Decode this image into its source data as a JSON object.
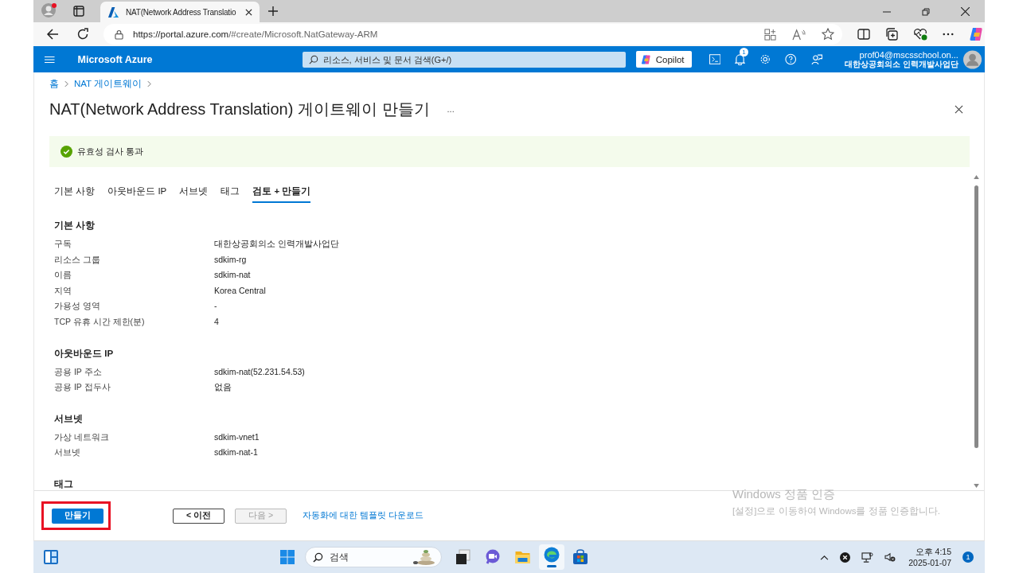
{
  "browser": {
    "tab_title": "NAT(Network Address Translatio",
    "url_host": "https://portal.azure.com",
    "url_path": "/#create/Microsoft.NatGateway-ARM"
  },
  "portal": {
    "brand": "Microsoft Azure",
    "search": {
      "placeholder": "리소스, 서비스 및 문서 검색(G+/)"
    },
    "copilot": "Copilot",
    "notification_count": "1",
    "account": "prof04@mscsschool.on...",
    "directory": "대한상공회의소 인력개발사업단"
  },
  "breadcrumb": [
    "홈",
    "NAT 게이트웨이"
  ],
  "title": "NAT(Network Address Translation) 게이트웨이 만들기",
  "more": "...",
  "banner": {
    "text": "유효성 검사 통과"
  },
  "tabs": [
    {
      "label": "기본 사항",
      "selected": false
    },
    {
      "label": "아웃바운드 IP",
      "selected": false
    },
    {
      "label": "서브넷",
      "selected": false
    },
    {
      "label": "태그",
      "selected": false
    },
    {
      "label": "검토 + 만들기",
      "selected": true
    }
  ],
  "sections": [
    {
      "heading": "기본 사항",
      "rows": [
        {
          "label": "구독",
          "value": "대한상공회의소 인력개발사업단"
        },
        {
          "label": "리소스 그룹",
          "value": "sdkim-rg"
        },
        {
          "label": "이름",
          "value": "sdkim-nat"
        },
        {
          "label": "지역",
          "value": "Korea Central"
        },
        {
          "label": "가용성 영역",
          "value": "-"
        },
        {
          "label": "TCP 유휴 시간 제한(분)",
          "value": "4"
        }
      ]
    },
    {
      "heading": "아웃바운드 IP",
      "rows": [
        {
          "label": "공용 IP 주소",
          "value": "sdkim-nat(52.231.54.53)"
        },
        {
          "label": "공용 IP 접두사",
          "value": "없음"
        }
      ]
    },
    {
      "heading": "서브넷",
      "rows": [
        {
          "label": "가상 네트워크",
          "value": "sdkim-vnet1"
        },
        {
          "label": "서브넷",
          "value": "sdkim-nat-1"
        }
      ]
    },
    {
      "heading": "태그"
    }
  ],
  "footer": {
    "create": {
      "label": "만들기",
      "highlighted": true
    },
    "buttons": [
      {
        "label": "< 이전",
        "disabled": false
      },
      {
        "label": "다음 >",
        "disabled": true
      }
    ],
    "link": "자동화에 대한 템플릿 다운로드"
  },
  "activation": {
    "title": "Windows 정품 인증",
    "text": "[설정]으로 이동하여 Windows를 정품 인증합니다."
  },
  "taskbar": {
    "search": {
      "placeholder": "검색"
    },
    "time": "오후 4:15",
    "date": "2025-01-07",
    "notification_count": "1"
  }
}
